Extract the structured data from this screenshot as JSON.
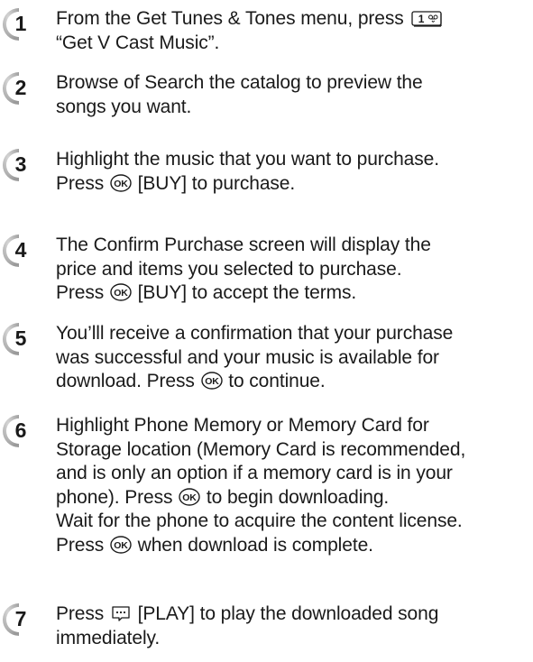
{
  "steps": [
    {
      "number": "1",
      "segments": [
        {
          "type": "text",
          "value": "From the Get Tunes & Tones menu, press "
        },
        {
          "type": "icon",
          "name": "key-1-icon"
        },
        {
          "type": "br"
        },
        {
          "type": "text",
          "value": "“Get V Cast Music”."
        }
      ]
    },
    {
      "number": "2",
      "segments": [
        {
          "type": "text",
          "value": "Browse of Search the catalog to preview the"
        },
        {
          "type": "br"
        },
        {
          "type": "text",
          "value": "songs you want."
        }
      ]
    },
    {
      "number": "3",
      "segments": [
        {
          "type": "text",
          "value": "Highlight the music that you want to purchase."
        },
        {
          "type": "br"
        },
        {
          "type": "text",
          "value": "Press "
        },
        {
          "type": "icon",
          "name": "ok-key-icon"
        },
        {
          "type": "text",
          "value": " [BUY] to purchase."
        }
      ]
    },
    {
      "number": "4",
      "segments": [
        {
          "type": "text",
          "value": "The Confirm Purchase screen will display the"
        },
        {
          "type": "br"
        },
        {
          "type": "text",
          "value": "price and items you selected to purchase."
        },
        {
          "type": "br"
        },
        {
          "type": "text",
          "value": "Press "
        },
        {
          "type": "icon",
          "name": "ok-key-icon"
        },
        {
          "type": "text",
          "value": " [BUY] to accept the terms."
        }
      ]
    },
    {
      "number": "5",
      "segments": [
        {
          "type": "text",
          "value": "You’lll receive a confirmation that your purchase"
        },
        {
          "type": "br"
        },
        {
          "type": "text",
          "value": "was successful and your music is available for"
        },
        {
          "type": "br"
        },
        {
          "type": "text",
          "value": "download. Press "
        },
        {
          "type": "icon",
          "name": "ok-key-icon"
        },
        {
          "type": "text",
          "value": " to continue."
        }
      ]
    },
    {
      "number": "6",
      "segments": [
        {
          "type": "text",
          "value": "Highlight Phone Memory or Memory Card for"
        },
        {
          "type": "br"
        },
        {
          "type": "text",
          "value": "Storage location (Memory Card is recommended,"
        },
        {
          "type": "br"
        },
        {
          "type": "text",
          "value": "and is only an option if a memory card is in your"
        },
        {
          "type": "br"
        },
        {
          "type": "text",
          "value": "phone). Press "
        },
        {
          "type": "icon",
          "name": "ok-key-icon"
        },
        {
          "type": "text",
          "value": " to begin downloading."
        },
        {
          "type": "br"
        },
        {
          "type": "text",
          "value": "Wait for the phone to acquire the content license."
        },
        {
          "type": "br"
        },
        {
          "type": "text",
          "value": "Press "
        },
        {
          "type": "icon",
          "name": "ok-key-icon"
        },
        {
          "type": "text",
          "value": " when download is complete."
        }
      ]
    },
    {
      "number": "7",
      "segments": [
        {
          "type": "text",
          "value": "Press "
        },
        {
          "type": "icon",
          "name": "menu-key-icon"
        },
        {
          "type": "text",
          "value": " [PLAY] to play the downloaded song"
        },
        {
          "type": "br"
        },
        {
          "type": "text",
          "value": "immediately."
        }
      ]
    }
  ],
  "colors": {
    "badge_fill": "#9a9a9a",
    "badge_highlight": "#d8d8d8",
    "badge_number": "#1a1a1a",
    "text": "#1a1a1a"
  }
}
